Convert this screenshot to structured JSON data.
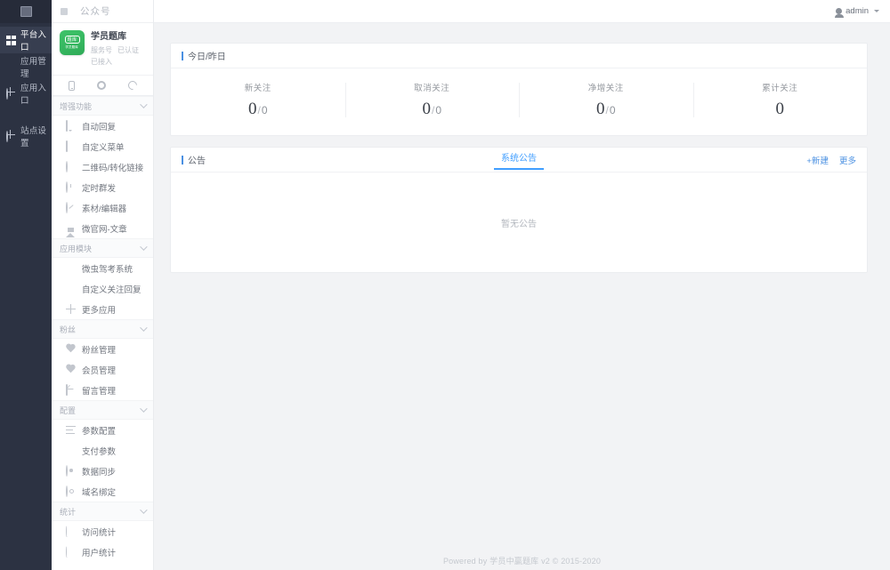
{
  "rail": {
    "logo_icon": "app-logo-icon",
    "items": [
      {
        "label": "平台入口",
        "icon": "grid-icon",
        "active": true
      },
      {
        "label": "应用管理",
        "icon": "cloud-icon",
        "active": false
      },
      {
        "label": "应用入口",
        "icon": "globe-icon",
        "active": false
      },
      {
        "label": "站点设置",
        "icon": "settings-globe-icon",
        "active": false
      }
    ]
  },
  "sidebar": {
    "top": {
      "menu_icon": "collapse-icon",
      "title": "公众号"
    },
    "account": {
      "logo_text": "题库",
      "logo_subtext": "学员题库",
      "name": "学员题库",
      "type": "服务号",
      "verified": "已认证",
      "status": "已接入",
      "tools": [
        {
          "name": "mobile-preview-icon",
          "label": "mobile"
        },
        {
          "name": "gear-icon",
          "label": "settings"
        },
        {
          "name": "refresh-icon",
          "label": "refresh"
        }
      ]
    },
    "groups": [
      {
        "label": "增强功能",
        "items": [
          {
            "label": "自动回复",
            "icon": "chat-bubble-icon"
          },
          {
            "label": "自定义菜单",
            "icon": "document-icon"
          },
          {
            "label": "二维码/转化链接",
            "icon": "qrcode-icon"
          },
          {
            "label": "定时群发",
            "icon": "clock-icon"
          },
          {
            "label": "素材/编辑器",
            "icon": "pen-icon"
          },
          {
            "label": "微官网-文章",
            "icon": "home-icon"
          }
        ]
      },
      {
        "label": "应用模块",
        "items": [
          {
            "label": "微虫驾考系统",
            "icon": "image-icon"
          },
          {
            "label": "自定义关注回复",
            "icon": "image-icon"
          },
          {
            "label": "更多应用",
            "icon": "plus-icon"
          }
        ]
      },
      {
        "label": "粉丝",
        "items": [
          {
            "label": "粉丝管理",
            "icon": "heart-icon"
          },
          {
            "label": "会员管理",
            "icon": "heart-icon"
          },
          {
            "label": "留言管理",
            "icon": "mail-icon"
          }
        ]
      },
      {
        "label": "配置",
        "items": [
          {
            "label": "参数配置",
            "icon": "list-icon"
          },
          {
            "label": "支付参数",
            "icon": "card-icon"
          },
          {
            "label": "数据同步",
            "icon": "sync-icon"
          },
          {
            "label": "域名绑定",
            "icon": "domain-icon"
          }
        ]
      },
      {
        "label": "统计",
        "items": [
          {
            "label": "访问统计",
            "icon": "chart-icon"
          },
          {
            "label": "用户统计",
            "icon": "chart-icon"
          }
        ]
      }
    ]
  },
  "topbar": {
    "user_icon": "user-icon",
    "username": "admin",
    "caret_icon": "chevron-down-icon"
  },
  "stats_panel": {
    "title": "今日/昨日",
    "items": [
      {
        "label": "新关注",
        "today": "0",
        "sep": "/",
        "yesterday": "0"
      },
      {
        "label": "取消关注",
        "today": "0",
        "sep": "/",
        "yesterday": "0"
      },
      {
        "label": "净增关注",
        "today": "0",
        "sep": "/",
        "yesterday": "0"
      },
      {
        "label": "累计关注",
        "today": "0",
        "sep": "",
        "yesterday": ""
      }
    ]
  },
  "notice_panel": {
    "title": "公告",
    "tab": "系统公告",
    "create_label": "+新建",
    "more_label": "更多",
    "empty_text": "暂无公告"
  },
  "footer": {
    "text": "Powered by 学员中赢题库 v2 © 2015-2020"
  },
  "colors": {
    "rail_bg": "#2c3242",
    "rail_active_bg": "#373e50",
    "accent_blue": "#409eff",
    "title_bar_blue": "#4a90e2",
    "brand_green": "#35b65f",
    "page_bg": "#f2f3f5"
  }
}
